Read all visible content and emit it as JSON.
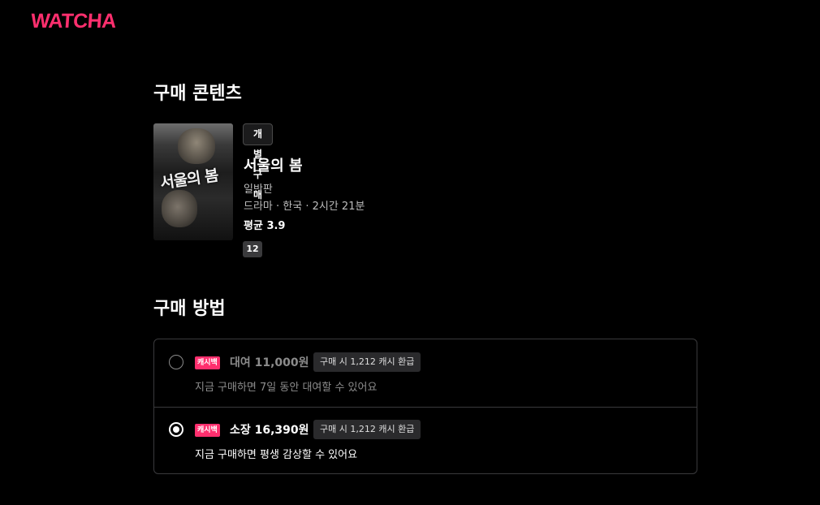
{
  "header": {
    "logo": "WATCHA"
  },
  "content_section": {
    "title": "구매 콘텐츠",
    "purchase_type_badge": "개별 구매",
    "movie": {
      "poster_title": "서울의 봄",
      "title": "서울의 봄",
      "edition": "일반판",
      "meta": "드라마 · 한국 · 2시간 21분",
      "rating": "평균 3.9",
      "age_rating": "12"
    }
  },
  "method_section": {
    "title": "구매 방법",
    "options": [
      {
        "cashback_badge": "캐시백",
        "price": "대여 11,000원",
        "refund": "구매 시 1,212 캐시 환급",
        "description": "지금 구매하면 7일 동안 대여할 수 있어요",
        "selected": false
      },
      {
        "cashback_badge": "캐시백",
        "price": "소장 16,390원",
        "refund": "구매 시 1,212 캐시 환급",
        "description": "지금 구매하면 평생 감상할 수 있어요",
        "selected": true
      }
    ]
  },
  "colors": {
    "brand": "#ff2f6e",
    "background": "#000000",
    "muted_text": "#8c8c8c"
  }
}
